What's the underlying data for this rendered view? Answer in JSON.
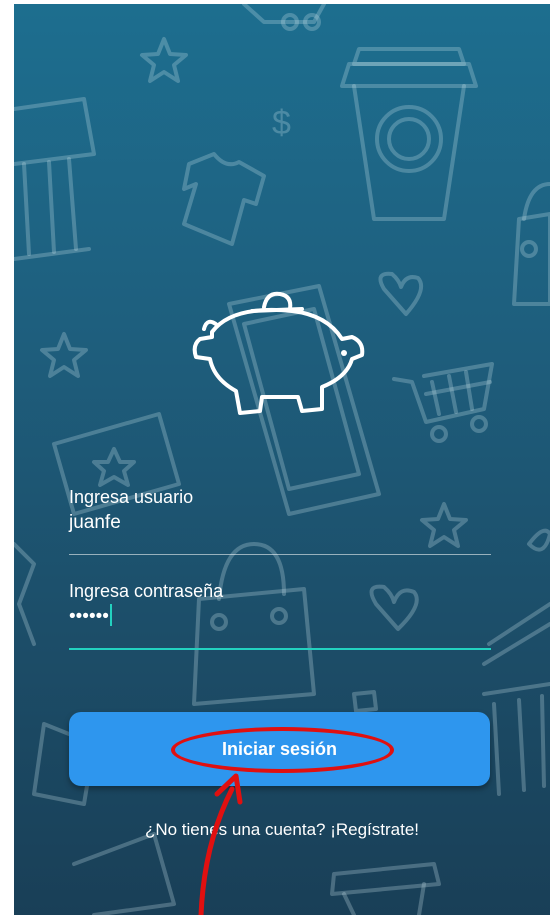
{
  "username_field": {
    "label": "Ingresa usuario",
    "value": "juanfe"
  },
  "password_field": {
    "label": "Ingresa contraseña",
    "value": "••••••"
  },
  "login_button": {
    "label": "Iniciar sesión"
  },
  "register_link": {
    "label": "¿No tienes una cuenta? ¡Regístrate!"
  },
  "icons": {
    "logo": "piggy-bank-icon",
    "background": [
      "star-icon",
      "dollar-icon",
      "tshirt-icon",
      "coffee-cup-icon",
      "bank-icon",
      "shopping-bag-icon",
      "heart-icon",
      "shopping-cart-icon",
      "ticket-icon",
      "smartphone-icon"
    ]
  },
  "colors": {
    "background_top": "#1d6e8f",
    "background_bottom": "#193f57",
    "button": "#2e96ee",
    "focus_accent": "#23d1bf",
    "annotation": "#e01010"
  }
}
